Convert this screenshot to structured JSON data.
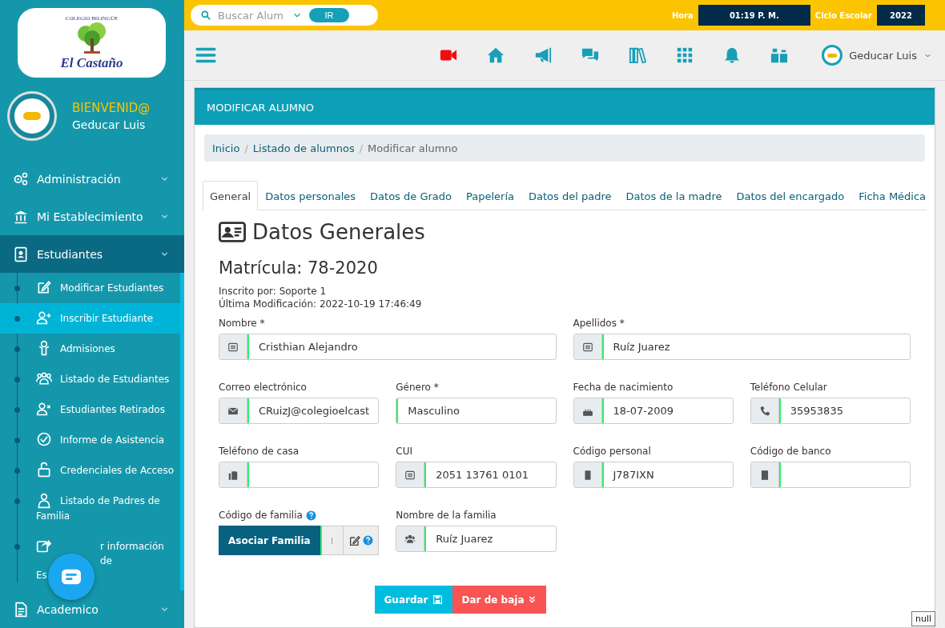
{
  "sidebar": {
    "logo": {
      "arc_text": "COLEGIO BILINGÜE",
      "name": "El Castaño"
    },
    "welcome": "BIENVENID@",
    "user": "Geducar Luis",
    "menu": [
      {
        "label": "Administración",
        "expanded": false
      },
      {
        "label": "Mi Establecimiento",
        "expanded": false
      },
      {
        "label": "Estudiantes",
        "expanded": true,
        "children": [
          {
            "label": "Modificar Estudiantes",
            "selected": false
          },
          {
            "label": "Inscribir Estudiante",
            "selected": true
          },
          {
            "label": "Admisiones",
            "selected": false
          },
          {
            "label": "Listado de Estudiantes",
            "selected": false
          },
          {
            "label": "Estudiantes Retirados",
            "selected": false
          },
          {
            "label": "Informe de Asistencia",
            "selected": false
          },
          {
            "label": "Credenciales de Acceso",
            "selected": false
          },
          {
            "label": "Listado de Padres de Familia",
            "selected": false
          },
          {
            "label_lines": [
              "r información de",
              "Es"
            ],
            "selected": false
          }
        ]
      },
      {
        "label": "Academico",
        "expanded": false
      }
    ]
  },
  "topbar": {
    "search": {
      "placeholder": "Buscar Alum"
    },
    "go": "IR",
    "time_label": "Hora",
    "time": "01:19 P. M.",
    "cycle_label": "Ciclo Escolar",
    "cycle": "2022"
  },
  "navbar": {
    "icons": [
      {
        "kind": "video"
      },
      {
        "kind": "home"
      },
      {
        "kind": "megaphone"
      },
      {
        "kind": "chat"
      },
      {
        "kind": "books"
      },
      {
        "kind": "grid"
      },
      {
        "kind": "bell"
      },
      {
        "kind": "gifts"
      }
    ],
    "user": "Geducar Luis"
  },
  "card": {
    "title": "MODIFICAR ALUMNO",
    "breadcrumb": [
      {
        "label": "Inicio"
      },
      {
        "separator": "/",
        "label": "Listado de alumnos"
      },
      {
        "separator": "/",
        "label": "Modificar alumno"
      }
    ],
    "tabs": [
      {
        "label": "General",
        "selected": true
      },
      {
        "label": "Datos personales",
        "selected": false
      },
      {
        "label": "Datos de Grado",
        "selected": false
      },
      {
        "label": "Papelería",
        "selected": false
      },
      {
        "label": "Datos del padre",
        "selected": false
      },
      {
        "label": "Datos de la madre",
        "selected": false
      },
      {
        "label": "Datos del encargado",
        "selected": false
      },
      {
        "label": "Ficha Médica",
        "selected": false
      }
    ],
    "section_title": "Datos Generales",
    "enrollment": "Matrícula: 78-2020",
    "registered_by": "Inscrito por: Soporte 1",
    "last_modified": "Última Modificación: 2022-10-19 17:46:49",
    "fields": [
      {
        "label": "Nombre *",
        "value": "Cristhian Alejandro"
      },
      {
        "label": "Apellidos *",
        "value": "Ruíz Juarez"
      },
      {
        "label": "Correo electrónico",
        "value": "CRuizJ@colegioelcast"
      },
      {
        "label": "Género *",
        "value": "Masculino"
      },
      {
        "label": "Fecha de nacimiento",
        "value": "18-07-2009"
      },
      {
        "label": "Teléfono Celular",
        "value": "35953835"
      },
      {
        "label": "Teléfono de casa"
      },
      {
        "label": "CUI",
        "value": "2051 13761 0101"
      },
      {
        "label": "Código personal",
        "value": "J787IXN"
      },
      {
        "label": "Código de banco"
      }
    ],
    "family_code": {
      "label": "Código de familia",
      "button": "Asociar Familia"
    },
    "family_name": {
      "label": "Nombre de la familia",
      "value": "Ruíz Juarez"
    },
    "save": "Guardar",
    "deactivate": "Dar de baja",
    "tooltip": "null"
  }
}
